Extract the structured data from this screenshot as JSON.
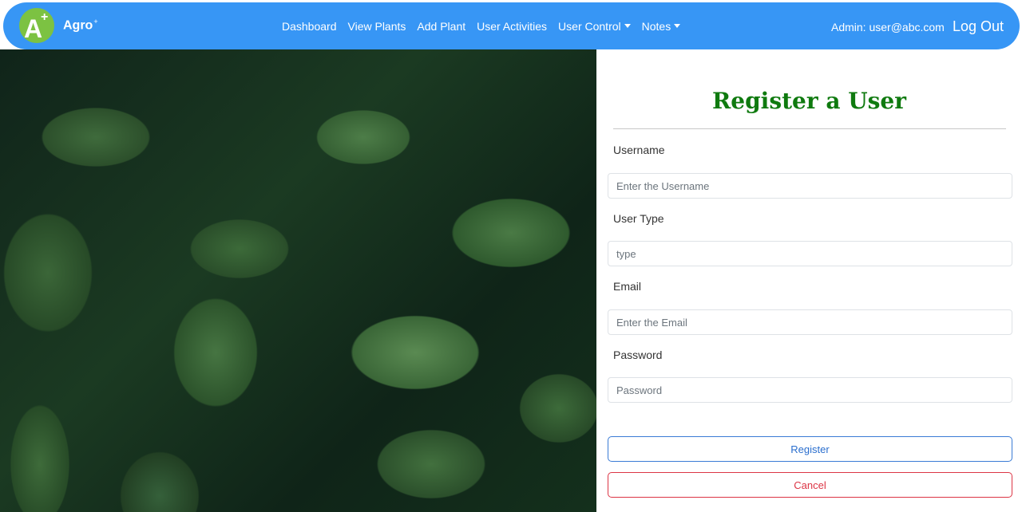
{
  "navbar": {
    "brand": "Agro",
    "brand_sup": "+",
    "logo_letter": "A",
    "logo_plus": "+",
    "links": [
      "Dashboard",
      "View Plants",
      "Add Plant",
      "User Activities",
      "User Control",
      "Notes"
    ],
    "admin_text": "Admin: user@abc.com",
    "logout": "Log Out",
    "bg_color": "#3796f5"
  },
  "form": {
    "title": "Register a User",
    "title_color": "#0f7a0f",
    "fields": [
      {
        "label": "Username",
        "placeholder": "Enter the Username",
        "value": ""
      },
      {
        "label": "User Type",
        "placeholder": "type",
        "value": ""
      },
      {
        "label": "Email",
        "placeholder": "Enter the Email",
        "value": ""
      },
      {
        "label": "Password",
        "placeholder": "Password",
        "value": ""
      }
    ],
    "register_label": "Register",
    "cancel_label": "Cancel"
  }
}
